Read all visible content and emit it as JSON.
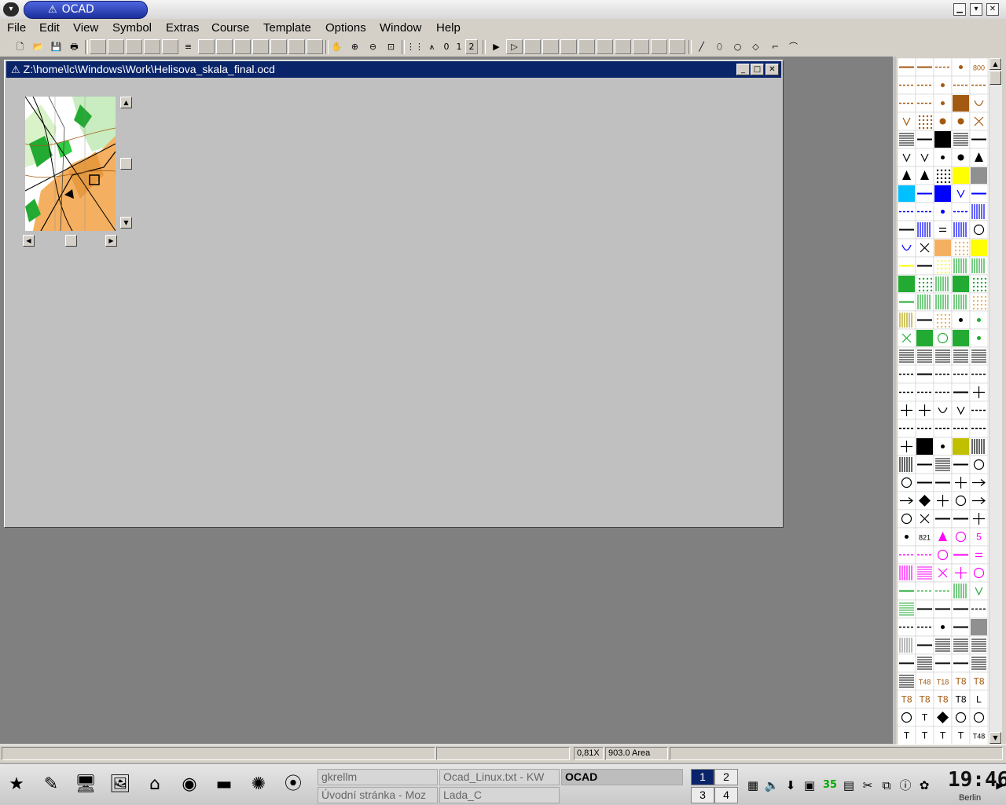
{
  "window": {
    "title": "OCAD",
    "app_menu_icon": "chevron-down-icon"
  },
  "menubar": [
    {
      "label": "File",
      "key": "F"
    },
    {
      "label": "Edit",
      "key": "E"
    },
    {
      "label": "View",
      "key": "V"
    },
    {
      "label": "Symbol",
      "key": "S"
    },
    {
      "label": "Extras",
      "key": "x"
    },
    {
      "label": "Course",
      "key": "C"
    },
    {
      "label": "Template",
      "key": "T"
    },
    {
      "label": "Options",
      "key": "O"
    },
    {
      "label": "Window",
      "key": "W"
    },
    {
      "label": "Help",
      "key": "H"
    }
  ],
  "toolbar": {
    "zoom_level_1": "0",
    "zoom_level_2": "1",
    "zoom_level_3": "2"
  },
  "document": {
    "path": "Z:\\home\\lc\\Windows\\Work\\Helisova_skala_final.ocd"
  },
  "symbol_box": {
    "label_800": "800",
    "label_821": "821",
    "label_5": "5",
    "text_symbols": [
      "T48",
      "T18",
      "T8",
      "T8",
      "T8",
      "T8",
      "T8",
      "T8",
      "L",
      "T",
      "T",
      "T",
      "T",
      "T"
    ]
  },
  "status": {
    "zoom": "0,81X",
    "area": "903.0 Area"
  },
  "taskbar": {
    "tasks": [
      {
        "label": "gkrellm",
        "active": false
      },
      {
        "label": "Ocad_Linux.txt - KW",
        "active": false
      },
      {
        "label": "OCAD",
        "active": true
      },
      {
        "label": "Úvodní stránka - Moz",
        "active": false
      },
      {
        "label": "Lada_C",
        "active": false
      }
    ],
    "desktops": [
      "1",
      "2",
      "3",
      "4"
    ],
    "clock": "19:46",
    "clock_city": "Berlin"
  },
  "colors": {
    "doc_title_bg": "#0a246a",
    "title_pill": "#2a44c4",
    "map_orange": "#f4b060",
    "map_green": "#22aa33",
    "symbol_yellow": "#ffff00",
    "symbol_magenta": "#ff00ff"
  }
}
